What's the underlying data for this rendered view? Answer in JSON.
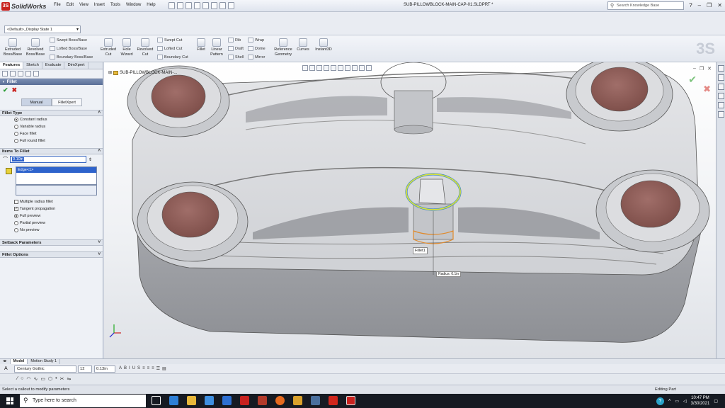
{
  "app": {
    "name": "SolidWorks",
    "document_title": "SUB-PILLOWBLOCK-MAIN-CAP-01.SLDPRT *"
  },
  "menus": [
    "File",
    "Edit",
    "View",
    "Insert",
    "Tools",
    "Window",
    "Help"
  ],
  "search": {
    "placeholder": "Search Knowledge Base"
  },
  "config": {
    "value": "<Default>_Display State 1"
  },
  "ribbon": {
    "extruded_boss": "Extruded Boss/Base",
    "revolved_boss": "Revolved Boss/Base",
    "swept_boss": "Swept Boss/Base",
    "lofted_boss": "Lofted Boss/Base",
    "boundary_boss": "Boundary Boss/Base",
    "extruded_cut": "Extruded Cut",
    "hole_wizard": "Hole Wizard",
    "revolved_cut": "Revolved Cut",
    "swept_cut": "Swept Cut",
    "lofted_cut": "Lofted Cut",
    "boundary_cut": "Boundary Cut",
    "fillet": "Fillet",
    "linear_pattern": "Linear Pattern",
    "rib": "Rib",
    "draft": "Draft",
    "shell": "Shell",
    "wrap": "Wrap",
    "dome": "Dome",
    "mirror": "Mirror",
    "reference_geometry": "Reference Geometry",
    "curves": "Curves",
    "instant3d": "Instant3D"
  },
  "panel_tabs": [
    "Features",
    "Sketch",
    "Evaluate",
    "DimXpert"
  ],
  "property_manager": {
    "title": "Fillet",
    "mode_manual": "Manual",
    "mode_filletxpert": "FilletXpert",
    "fillet_type": {
      "heading": "Fillet Type",
      "options": [
        "Constant radius",
        "Variable radius",
        "Face fillet",
        "Full round fillet"
      ]
    },
    "items_to_fillet": {
      "heading": "Items To Fillet",
      "radius": "0.10in",
      "edge_item": "Edge<1>",
      "multiple_radius": "Multiple radius fillet",
      "tangent_propagation": "Tangent propagation",
      "full_preview": "Full preview",
      "partial_preview": "Partial preview",
      "no_preview": "No preview"
    },
    "setback_heading": "Setback Parameters",
    "options_heading": "Fillet Options"
  },
  "viewport": {
    "part_name": "SUB-PILLOWBLOCK-MAIN-...",
    "callout_label": "Fillet1",
    "radius_label": "Radius: 0.1in"
  },
  "bottom_tabs": [
    "Model",
    "Motion Study 1"
  ],
  "format": {
    "font": "Century Gothic",
    "size": "12",
    "value": "0.13in"
  },
  "status": {
    "left": "Select a callout to modify parameters",
    "right": "Editing Part"
  },
  "taskbar": {
    "search_placeholder": "Type here to search",
    "time": "10:47 PM",
    "date": "3/30/2021"
  },
  "colors": {
    "accent": "#2e63cc",
    "brand_red": "#c8221f",
    "hole_fill": "#8d5a55"
  }
}
